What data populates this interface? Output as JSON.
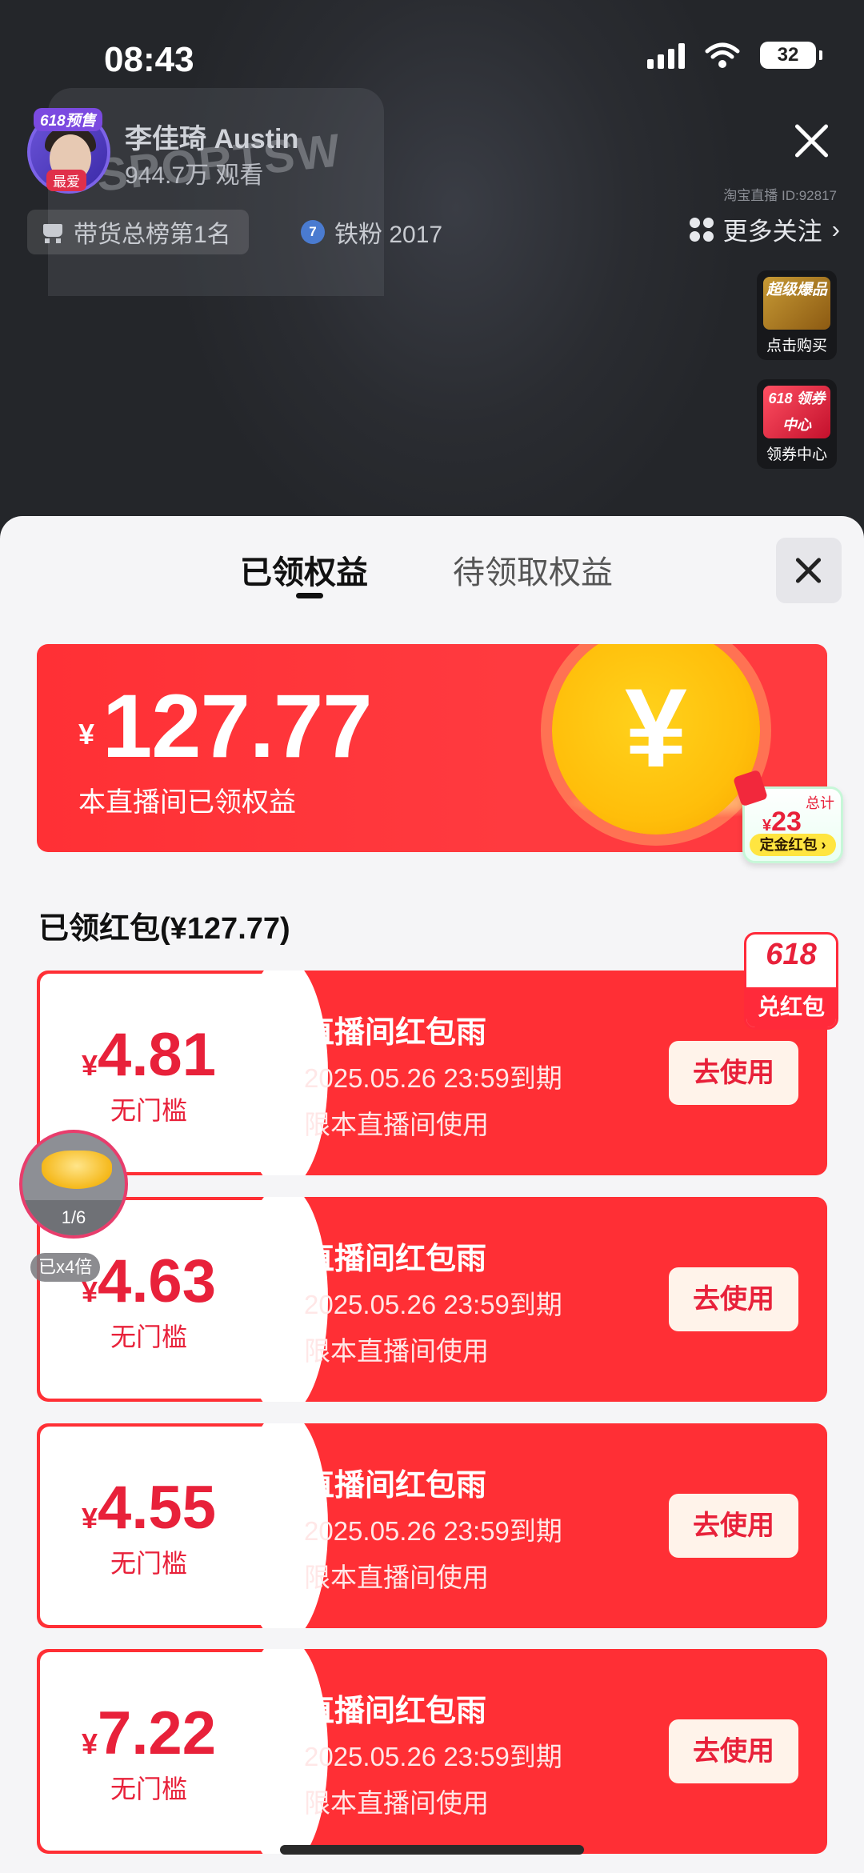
{
  "status_bar": {
    "time": "08:43",
    "battery": "32"
  },
  "host": {
    "name": "李佳琦 Austin",
    "viewers": "944.7万 观看",
    "avatar_badge": "618预售",
    "avatar_tag": "最爱",
    "room_id": "淘宝直播 ID:92817"
  },
  "chips": {
    "rank": "带货总榜第1名",
    "fan_level": "7",
    "fan_label": "铁粉 2017",
    "more_follow": "更多关注"
  },
  "promos": [
    {
      "title": "超级爆品",
      "caption": "点击购买"
    },
    {
      "title": "618 领券中心",
      "caption": "领券中心"
    }
  ],
  "sheet": {
    "tabs": [
      "已领权益",
      "待领取权益"
    ],
    "active_tab": 0,
    "summary": {
      "currency": "¥",
      "amount": "127.77",
      "label": "本直播间已领权益"
    },
    "deposit_badge": {
      "total_label": "总计",
      "currency": "¥",
      "value": "23",
      "label": "定金红包 ›"
    },
    "list_title": "已领红包(¥127.77)",
    "badge_618": {
      "line1": "618",
      "line2": "兑红包"
    },
    "coupons": [
      {
        "currency": "¥",
        "amount": "4.81",
        "condition": "无门槛",
        "title": "直播间红包雨",
        "expiry": "2025.05.26 23:59到期",
        "scope": "限本直播间使用",
        "button": "去使用"
      },
      {
        "currency": "¥",
        "amount": "4.63",
        "condition": "无门槛",
        "title": "直播间红包雨",
        "expiry": "2025.05.26 23:59到期",
        "scope": "限本直播间使用",
        "button": "去使用"
      },
      {
        "currency": "¥",
        "amount": "4.55",
        "condition": "无门槛",
        "title": "直播间红包雨",
        "expiry": "2025.05.26 23:59到期",
        "scope": "限本直播间使用",
        "button": "去使用"
      },
      {
        "currency": "¥",
        "amount": "7.22",
        "condition": "无门槛",
        "title": "直播间红包雨",
        "expiry": "2025.05.26 23:59到期",
        "scope": "限本直播间使用",
        "button": "去使用"
      }
    ],
    "floating_task": {
      "progress": "1/6",
      "multiplier": "已x4倍"
    }
  },
  "colors": {
    "accent_red": "#ff2f35",
    "text_red": "#e8213a",
    "coin_gold": "#ffc20e"
  }
}
